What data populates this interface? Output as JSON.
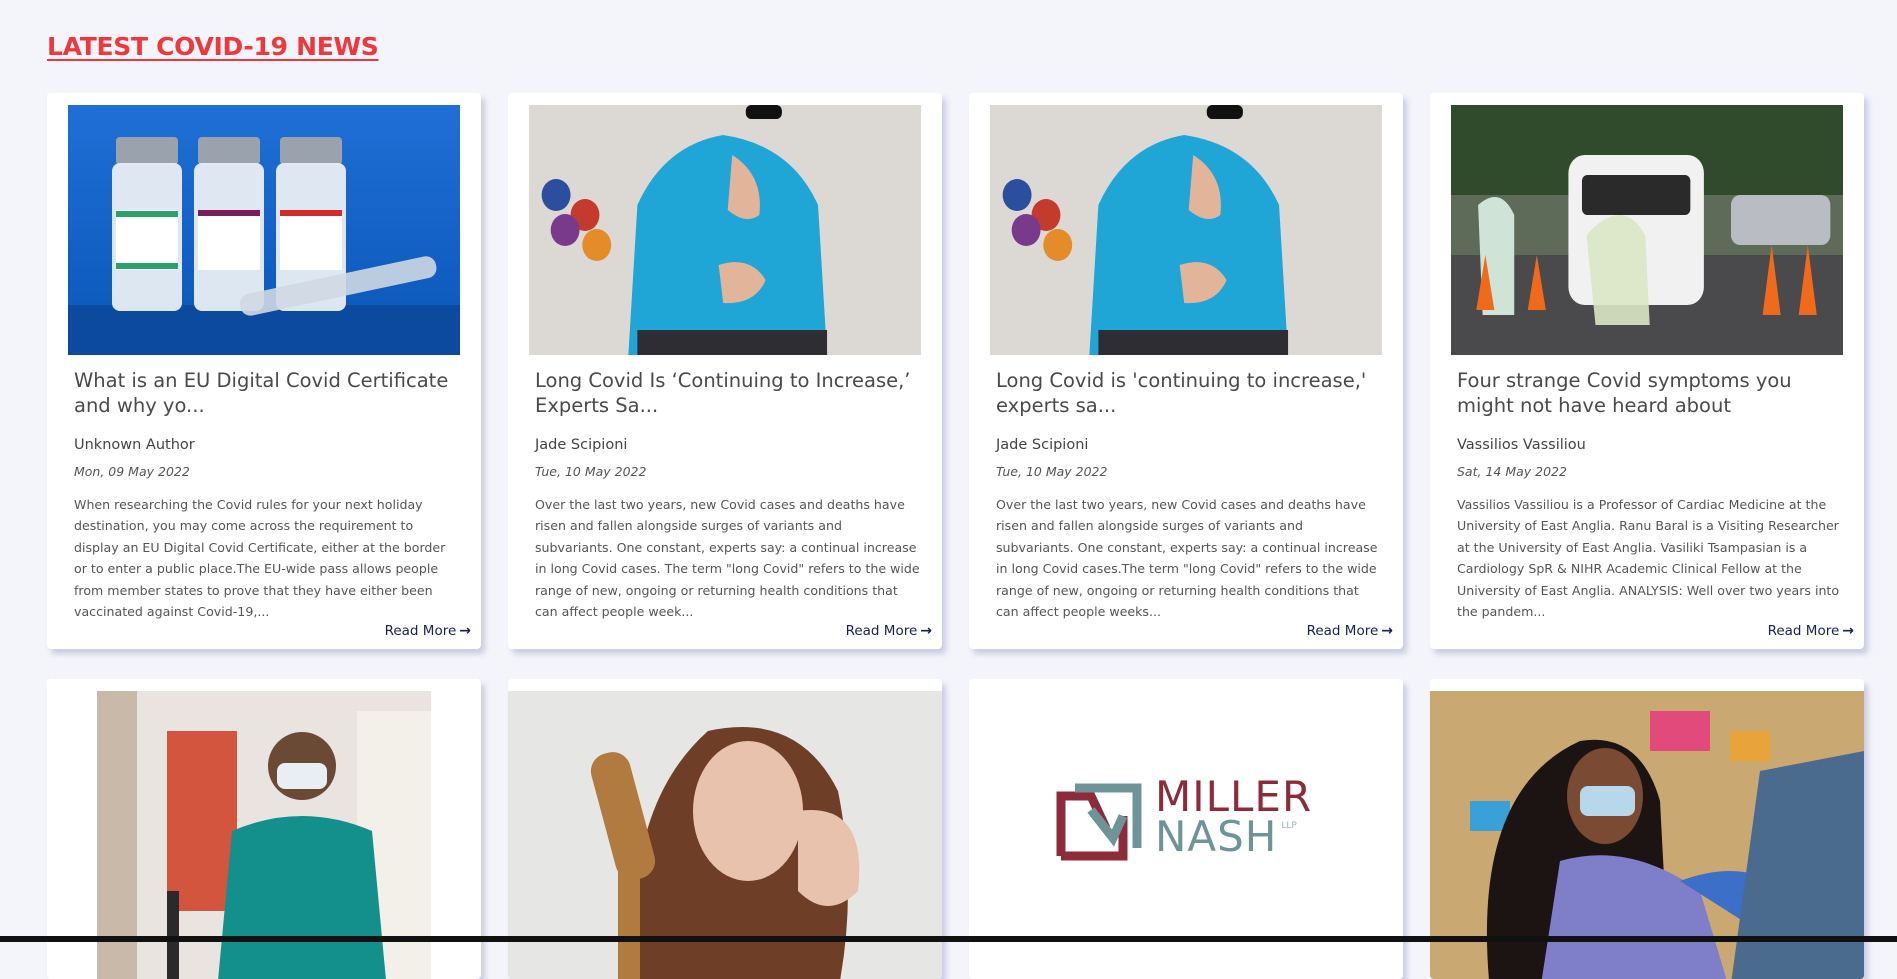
{
  "header": {
    "title": "LATEST COVID-19 NEWS"
  },
  "read_more_label": "Read More",
  "articles": [
    {
      "title": "What is an EU Digital Covid Certificate and why yo...",
      "author": "Unknown Author",
      "date": "Mon, 09 May 2022",
      "description": "When researching the Covid rules for your next holiday destination, you may come across the requirement to display an EU Digital Covid Certificate, either at the border or to enter a public place.The EU-wide pass allows people from member states to prove that they have either been vaccinated against Covid-19,...",
      "image": "vaccine-vials-image"
    },
    {
      "title": "Long Covid Is ‘Continuing to Increase,’ Experts Sa...",
      "author": "Jade Scipioni",
      "date": "Tue, 10 May 2022",
      "description": "Over the last two years, new Covid cases and deaths have risen and fallen alongside surges of variants and subvariants. One constant, experts say: a continual increase in long Covid cases. The term \"long Covid\" refers to the wide range of new, ongoing or returning health conditions that can affect people week...",
      "image": "man-chest-hand-image"
    },
    {
      "title": "Long Covid is 'continuing to increase,' experts sa...",
      "author": "Jade Scipioni",
      "date": "Tue, 10 May 2022",
      "description": "Over the last two years, new Covid cases and deaths have risen and fallen alongside surges of variants and subvariants. One constant, experts say: a continual increase in long Covid cases.The term \"long Covid\" refers to the wide range of new, ongoing or returning health conditions that can affect people weeks...",
      "image": "man-chest-hand-image"
    },
    {
      "title": "Four strange Covid symptoms you might not have heard about",
      "author": "Vassilios Vassiliou",
      "date": "Sat, 14 May 2022",
      "description": "Vassilios Vassiliou is a Professor of Cardiac Medicine at the University of East Anglia. Ranu Baral is a Visiting Researcher at the University of East Anglia. Vasiliki Tsampasian is a Cardiology SpR & NIHR Academic Clinical Fellow at the University of East Anglia. ANALYSIS: Well over two years into the pandem...",
      "image": "drive-through-testing-image"
    }
  ],
  "second_row": [
    {
      "image": "masked-man-image"
    },
    {
      "image": "hair-loss-woman-image"
    },
    {
      "image": "miller-nash-logo",
      "logo_text": {
        "line1": "MILLER",
        "line2": "NASH",
        "suffix": "LLP"
      }
    },
    {
      "image": "vaccination-image"
    }
  ],
  "colors": {
    "accent": "#f0383c",
    "link": "#1a1f5c",
    "background": "#f4f5fa"
  }
}
